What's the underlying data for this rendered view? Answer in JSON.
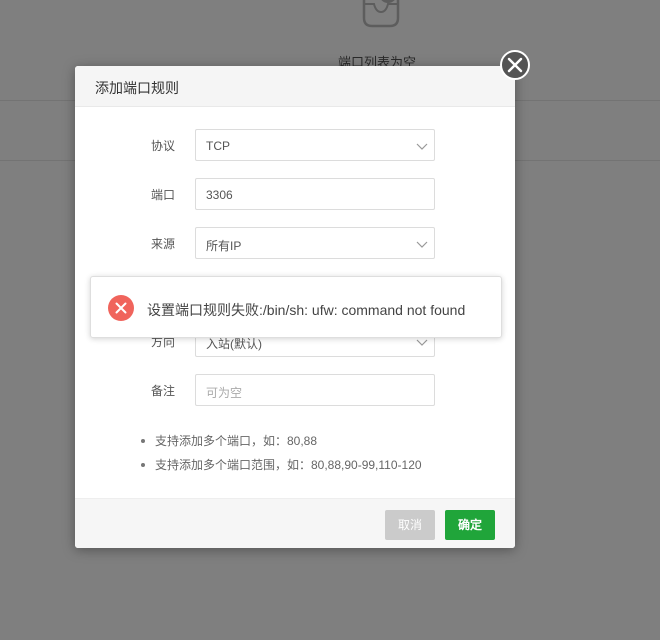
{
  "background": {
    "empty_text": "端口列表为空"
  },
  "dialog": {
    "title": "添加端口规则",
    "fields": [
      {
        "label": "协议",
        "value": "TCP",
        "type": "select"
      },
      {
        "label": "端口",
        "value": "3306",
        "type": "input"
      },
      {
        "label": "来源",
        "value": "所有IP",
        "type": "select"
      },
      {
        "label": "方向",
        "value": "入站(默认)",
        "type": "select"
      },
      {
        "label": "备注",
        "value": "",
        "placeholder": "可为空",
        "type": "input"
      }
    ],
    "tips": [
      "支持添加多个端口，如：80,88",
      "支持添加多个端口范围，如：80,88,90-99,110-120"
    ],
    "cancel_label": "取消",
    "confirm_label": "确定"
  },
  "toast": {
    "message": "设置端口规则失败:/bin/sh: ufw: command not found",
    "type": "error"
  },
  "colors": {
    "confirm": "#20a53a",
    "cancel": "#cbcbcb",
    "error": "#f0645c"
  }
}
